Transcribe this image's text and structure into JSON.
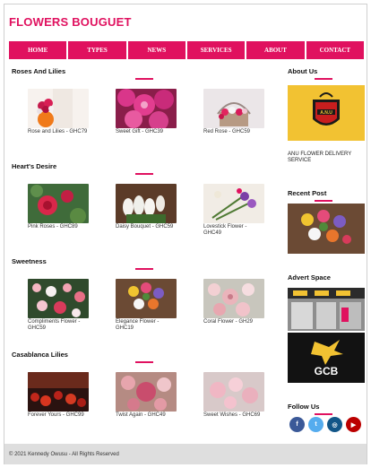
{
  "site": {
    "title": "FLOWERS BOUGUET"
  },
  "nav": [
    "HOME",
    "TYPES",
    "NEWS",
    "SERVICES",
    "ABOUT",
    "CONTACT"
  ],
  "sections": [
    {
      "title": "Roses And Lilies",
      "items": [
        {
          "caption": "Rose and Lilies - GHC79"
        },
        {
          "caption": "Sweet Gift - GHC39"
        },
        {
          "caption": "Red Rose - GHC59"
        }
      ]
    },
    {
      "title": "Heart's Desire",
      "items": [
        {
          "caption": "Pink Roses - GHC89"
        },
        {
          "caption": "Daisy Bouquet - GHC59"
        },
        {
          "caption": "Lovestick Flower - GHC49"
        }
      ]
    },
    {
      "title": "Sweetness",
      "items": [
        {
          "caption": "Compliments Flower - GHC59"
        },
        {
          "caption": "Elegance Flower - GHC19"
        },
        {
          "caption": "Coral Flower - GH29"
        }
      ]
    },
    {
      "title": "Casablanca Lilies",
      "items": [
        {
          "caption": "Forever Yours - GHC99"
        },
        {
          "caption": "Twist Again - GHC49"
        },
        {
          "caption": "Sweet Wishes - GHC69"
        }
      ]
    }
  ],
  "sidebar": {
    "about_title": "About Us",
    "about_logo_text": "A.N.U",
    "about_text": "ANU FLOWER DELIVERY SERVICE",
    "recent_title": "Recent Post",
    "advert_title": "Advert Space",
    "gcb_text": "GCB",
    "follow_title": "Follow Us",
    "social": [
      {
        "name": "facebook",
        "glyph": "f",
        "color": "#3b5998"
      },
      {
        "name": "twitter",
        "glyph": "t",
        "color": "#55acee"
      },
      {
        "name": "instagram",
        "glyph": "◎",
        "color": "#125688"
      },
      {
        "name": "youtube",
        "glyph": "▶",
        "color": "#bb0000"
      }
    ]
  },
  "footer": {
    "text": "© 2021 Kennedy Owusu - All Rights Reserved"
  }
}
